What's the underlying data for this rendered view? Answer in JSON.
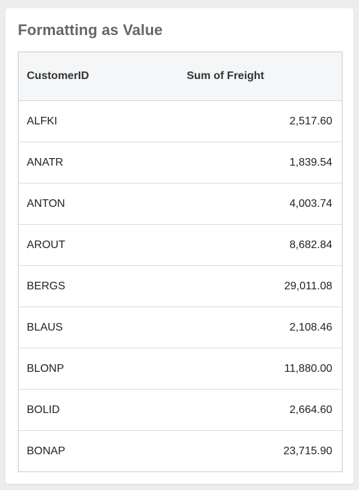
{
  "card": {
    "title": "Formatting as Value"
  },
  "grid": {
    "columns": [
      "CustomerID",
      "Sum of Freight"
    ],
    "rows": [
      {
        "customer": "ALFKI",
        "freight": "2,517.60"
      },
      {
        "customer": "ANATR",
        "freight": "1,839.54"
      },
      {
        "customer": "ANTON",
        "freight": "4,003.74"
      },
      {
        "customer": "AROUT",
        "freight": "8,682.84"
      },
      {
        "customer": "BERGS",
        "freight": "29,011.08"
      },
      {
        "customer": "BLAUS",
        "freight": "2,108.46"
      },
      {
        "customer": "BLONP",
        "freight": "11,880.00"
      },
      {
        "customer": "BOLID",
        "freight": "2,664.60"
      },
      {
        "customer": "BONAP",
        "freight": "23,715.90"
      }
    ]
  },
  "colors": {
    "title": "#666666",
    "header_bg": "#f4f6f8",
    "border": "#c9c9c9"
  }
}
